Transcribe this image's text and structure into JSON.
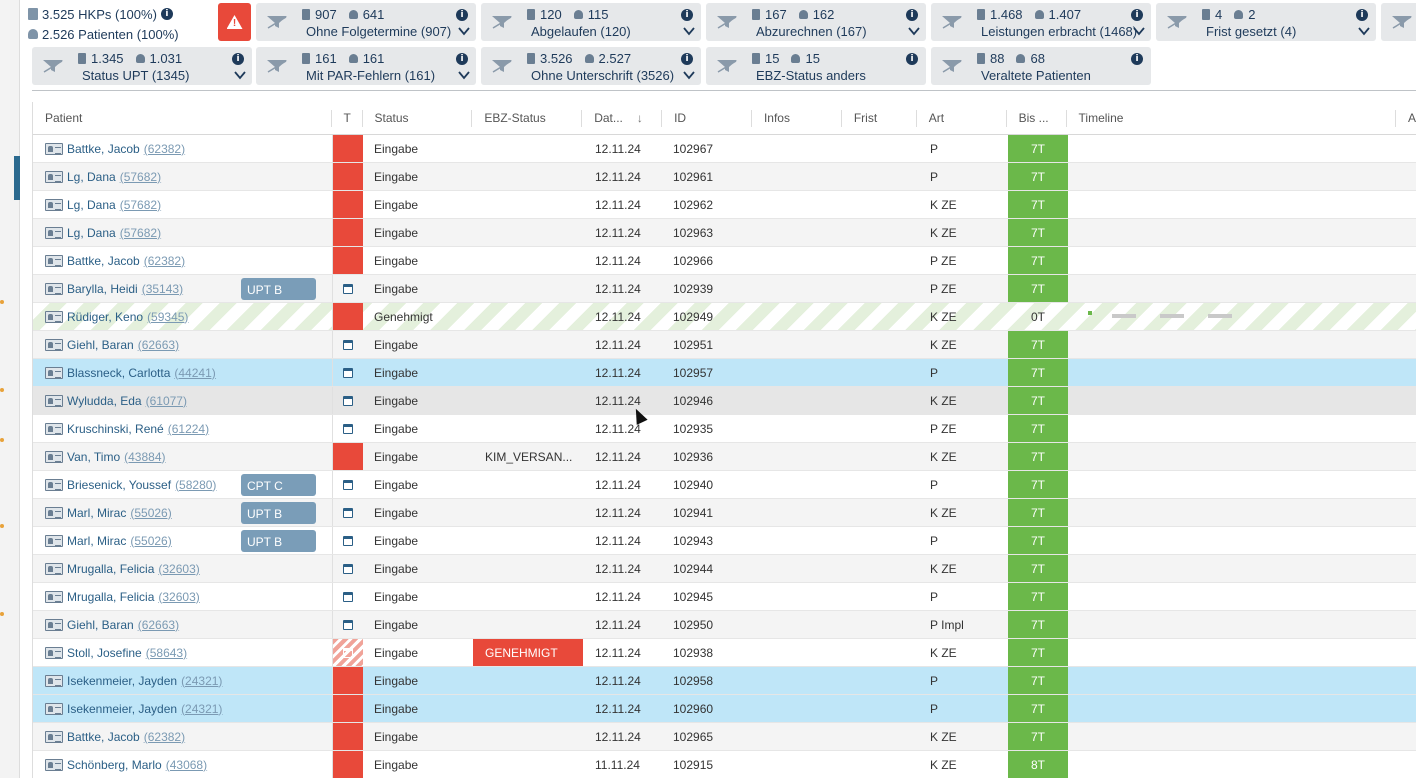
{
  "summary": {
    "hkps": "3.525 HKPs (100%)",
    "patients": "2.526 Patienten (100%)"
  },
  "filters": [
    {
      "docs": "907",
      "persons": "641",
      "label": "Ohne Folgetermine (907)",
      "dropdown": true
    },
    {
      "docs": "120",
      "persons": "115",
      "label": "Abgelaufen (120)",
      "dropdown": true
    },
    {
      "docs": "167",
      "persons": "162",
      "label": "Abzurechnen (167)",
      "dropdown": true
    },
    {
      "docs": "1.468",
      "persons": "1.407",
      "label": "Leistungen erbracht (1468)",
      "dropdown": true
    },
    {
      "docs": "4",
      "persons": "2",
      "label": "Frist gesetzt (4)",
      "dropdown": true
    },
    {
      "docs": "1.345",
      "persons": "1.031",
      "label": "Status UPT (1345)",
      "dropdown": true
    },
    {
      "docs": "161",
      "persons": "161",
      "label": "Mit PAR-Fehlern (161)",
      "dropdown": true
    },
    {
      "docs": "3.526",
      "persons": "2.527",
      "label": "Ohne Unterschrift (3526)",
      "dropdown": true
    },
    {
      "docs": "15",
      "persons": "15",
      "label": "EBZ-Status anders",
      "dropdown": false
    },
    {
      "docs": "88",
      "persons": "68",
      "label": "Veraltete Patienten",
      "dropdown": false
    }
  ],
  "columns": {
    "patient": "Patient",
    "t": "T",
    "status": "Status",
    "ebz": "EBZ-Status",
    "date": "Dat...",
    "id": "ID",
    "infos": "Infos",
    "frist": "Frist",
    "art": "Art",
    "bis": "Bis ...",
    "timeline": "Timeline",
    "extra": "A"
  },
  "rows": [
    {
      "name": "Battke, Jacob",
      "pid": "(62382)",
      "badge": "",
      "t": "red",
      "status": "Eingabe",
      "ebz": "",
      "date": "12.11.24",
      "id": "102967",
      "art": "P",
      "bis": "7T",
      "style": "",
      "bis_style": "green"
    },
    {
      "name": "Lg, Dana",
      "pid": "(57682)",
      "badge": "",
      "t": "red",
      "status": "Eingabe",
      "ebz": "",
      "date": "12.11.24",
      "id": "102961",
      "art": "P",
      "bis": "7T",
      "style": "alt",
      "bis_style": "green"
    },
    {
      "name": "Lg, Dana",
      "pid": "(57682)",
      "badge": "",
      "t": "red",
      "status": "Eingabe",
      "ebz": "",
      "date": "12.11.24",
      "id": "102962",
      "art": "K ZE",
      "bis": "7T",
      "style": "",
      "bis_style": "green"
    },
    {
      "name": "Lg, Dana",
      "pid": "(57682)",
      "badge": "",
      "t": "red",
      "status": "Eingabe",
      "ebz": "",
      "date": "12.11.24",
      "id": "102963",
      "art": "K ZE",
      "bis": "7T",
      "style": "alt",
      "bis_style": "green"
    },
    {
      "name": "Battke, Jacob",
      "pid": "(62382)",
      "badge": "",
      "t": "red",
      "status": "Eingabe",
      "ebz": "",
      "date": "12.11.24",
      "id": "102966",
      "art": "P ZE",
      "bis": "7T",
      "style": "",
      "bis_style": "green"
    },
    {
      "name": "Barylla, Heidi",
      "pid": "(35143)",
      "badge": "UPT B",
      "t": "cal",
      "status": "Eingabe",
      "ebz": "",
      "date": "12.11.24",
      "id": "102939",
      "art": "P ZE",
      "bis": "7T",
      "style": "alt",
      "bis_style": "green"
    },
    {
      "name": "Rüdiger, Keno",
      "pid": "(59345)",
      "badge": "",
      "t": "red",
      "status": "Genehmigt",
      "ebz": "",
      "date": "12.11.24",
      "id": "102949",
      "art": "K ZE",
      "bis": "0T",
      "style": "stripe",
      "bis_style": "plain",
      "timeline": true
    },
    {
      "name": "Giehl, Baran",
      "pid": "(62663)",
      "badge": "",
      "t": "cal",
      "status": "Eingabe",
      "ebz": "",
      "date": "12.11.24",
      "id": "102951",
      "art": "K ZE",
      "bis": "7T",
      "style": "alt",
      "bis_style": "green"
    },
    {
      "name": "Blassneck, Carlotta",
      "pid": "(44241)",
      "badge": "",
      "t": "cal",
      "status": "Eingabe",
      "ebz": "",
      "date": "12.11.24",
      "id": "102957",
      "art": "P",
      "bis": "7T",
      "style": "sel",
      "bis_style": "green"
    },
    {
      "name": "Wyludda, Eda",
      "pid": "(61077)",
      "badge": "",
      "t": "cal",
      "status": "Eingabe",
      "ebz": "",
      "date": "12.11.24",
      "id": "102946",
      "art": "K ZE",
      "bis": "7T",
      "style": "hov",
      "bis_style": "green"
    },
    {
      "name": "Kruschinski, René",
      "pid": "(61224)",
      "badge": "",
      "t": "cal",
      "status": "Eingabe",
      "ebz": "",
      "date": "12.11.24",
      "id": "102935",
      "art": "P ZE",
      "bis": "7T",
      "style": "",
      "bis_style": "green"
    },
    {
      "name": "Van, Timo",
      "pid": "(43884)",
      "badge": "",
      "t": "red",
      "status": "Eingabe",
      "ebz": "KIM_VERSAN...",
      "date": "12.11.24",
      "id": "102936",
      "art": "K ZE",
      "bis": "7T",
      "style": "alt",
      "bis_style": "green"
    },
    {
      "name": "Briesenick, Youssef",
      "pid": "(58280)",
      "badge": "CPT C",
      "t": "cal",
      "status": "Eingabe",
      "ebz": "",
      "date": "12.11.24",
      "id": "102940",
      "art": "P",
      "bis": "7T",
      "style": "",
      "bis_style": "green"
    },
    {
      "name": "Marl, Mirac",
      "pid": "(55026)",
      "badge": "UPT B",
      "t": "cal",
      "status": "Eingabe",
      "ebz": "",
      "date": "12.11.24",
      "id": "102941",
      "art": "K ZE",
      "bis": "7T",
      "style": "alt",
      "bis_style": "green"
    },
    {
      "name": "Marl, Mirac",
      "pid": "(55026)",
      "badge": "UPT B",
      "t": "cal",
      "status": "Eingabe",
      "ebz": "",
      "date": "12.11.24",
      "id": "102943",
      "art": "P",
      "bis": "7T",
      "style": "",
      "bis_style": "green"
    },
    {
      "name": "Mrugalla, Felicia",
      "pid": "(32603)",
      "badge": "",
      "t": "cal",
      "status": "Eingabe",
      "ebz": "",
      "date": "12.11.24",
      "id": "102944",
      "art": "K ZE",
      "bis": "7T",
      "style": "alt",
      "bis_style": "green"
    },
    {
      "name": "Mrugalla, Felicia",
      "pid": "(32603)",
      "badge": "",
      "t": "cal",
      "status": "Eingabe",
      "ebz": "",
      "date": "12.11.24",
      "id": "102945",
      "art": "P",
      "bis": "7T",
      "style": "",
      "bis_style": "green"
    },
    {
      "name": "Giehl, Baran",
      "pid": "(62663)",
      "badge": "",
      "t": "cal",
      "status": "Eingabe",
      "ebz": "",
      "date": "12.11.24",
      "id": "102950",
      "art": "P Impl",
      "bis": "7T",
      "style": "alt",
      "bis_style": "green"
    },
    {
      "name": "Stoll, Josefine",
      "pid": "(58643)",
      "badge": "",
      "t": "hatch",
      "status": "Eingabe",
      "ebz": "GENEHMIGT",
      "ebz_style": "red",
      "date": "12.11.24",
      "id": "102938",
      "art": "K ZE",
      "bis": "7T",
      "style": "",
      "bis_style": "green"
    },
    {
      "name": "Isekenmeier, Jayden",
      "pid": "(24321)",
      "badge": "",
      "t": "red",
      "status": "Eingabe",
      "ebz": "",
      "date": "12.11.24",
      "id": "102958",
      "art": "P",
      "bis": "7T",
      "style": "sel",
      "bis_style": "green"
    },
    {
      "name": "Isekenmeier, Jayden",
      "pid": "(24321)",
      "badge": "",
      "t": "red",
      "status": "Eingabe",
      "ebz": "",
      "date": "12.11.24",
      "id": "102960",
      "art": "P",
      "bis": "7T",
      "style": "sel",
      "bis_style": "green"
    },
    {
      "name": "Battke, Jacob",
      "pid": "(62382)",
      "badge": "",
      "t": "red",
      "status": "Eingabe",
      "ebz": "",
      "date": "12.11.24",
      "id": "102965",
      "art": "K ZE",
      "bis": "7T",
      "style": "alt",
      "bis_style": "green"
    },
    {
      "name": "Schönberg, Marlo",
      "pid": "(43068)",
      "badge": "",
      "t": "red",
      "status": "Eingabe",
      "ebz": "",
      "date": "11.11.24",
      "id": "102915",
      "art": "K ZE",
      "bis": "8T",
      "style": "",
      "bis_style": "green"
    }
  ],
  "colors": {
    "accent_red": "#e8493a",
    "ok_green": "#6bb84a",
    "selected_row": "#bfe6f8",
    "badge": "#7a9db8"
  },
  "icons": {
    "warning": "warning-triangle-icon",
    "filter": "filter-funnel-icon",
    "document": "document-icon",
    "person": "person-icon",
    "info": "info-icon",
    "calendar": "calendar-icon",
    "patient_card": "patient-card-icon"
  }
}
